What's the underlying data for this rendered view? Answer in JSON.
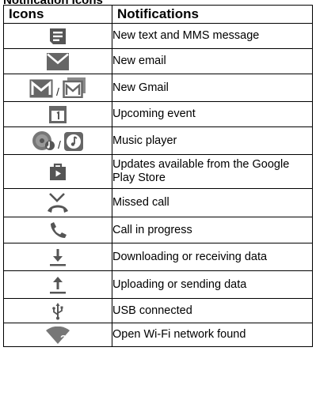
{
  "heading": "Notification Icons",
  "table": {
    "headers": {
      "icons": "Icons",
      "notifications": "Notifications"
    },
    "rows": [
      {
        "icons": [
          "message-icon"
        ],
        "text": "New text and MMS message"
      },
      {
        "icons": [
          "email-envelope-icon"
        ],
        "text": "New email"
      },
      {
        "icons": [
          "gmail-icon",
          "gmail-multiple-icon"
        ],
        "separator": "/",
        "text": "New Gmail"
      },
      {
        "icons": [
          "calendar-icon"
        ],
        "text": "Upcoming event"
      },
      {
        "icons": [
          "music-disc-icon",
          "music-note-icon"
        ],
        "separator": "/",
        "text": "Music player"
      },
      {
        "icons": [
          "play-store-bag-icon"
        ],
        "text": "Updates available from the Google Play Store"
      },
      {
        "icons": [
          "missed-call-icon"
        ],
        "text": "Missed call"
      },
      {
        "icons": [
          "phone-call-icon"
        ],
        "text": "Call in progress"
      },
      {
        "icons": [
          "download-icon"
        ],
        "text": "Downloading or receiving data"
      },
      {
        "icons": [
          "upload-icon"
        ],
        "text": "Uploading or sending data"
      },
      {
        "icons": [
          "usb-icon"
        ],
        "text": "USB connected"
      },
      {
        "icons": [
          "wifi-open-icon"
        ],
        "text": "Open Wi-Fi network found"
      }
    ]
  },
  "colors": {
    "icon": "#555555",
    "border": "#000000"
  }
}
